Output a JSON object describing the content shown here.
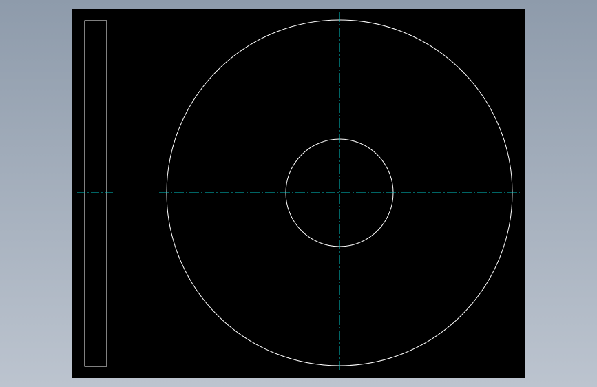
{
  "viewport": {
    "background_gradient_top": "#8e9bab",
    "background_gradient_bottom": "#bcc4cf"
  },
  "drawing": {
    "paper_color": "#000000",
    "outline_color": "#ffffff",
    "centerline_color": "#00c8c8",
    "centerline_style": "dash-dot",
    "views": [
      {
        "kind": "side-view",
        "shape": "rectangle"
      },
      {
        "kind": "front-view",
        "shape": "concentric-circles",
        "circles": [
          "outer-diameter",
          "bore-diameter"
        ]
      }
    ]
  }
}
